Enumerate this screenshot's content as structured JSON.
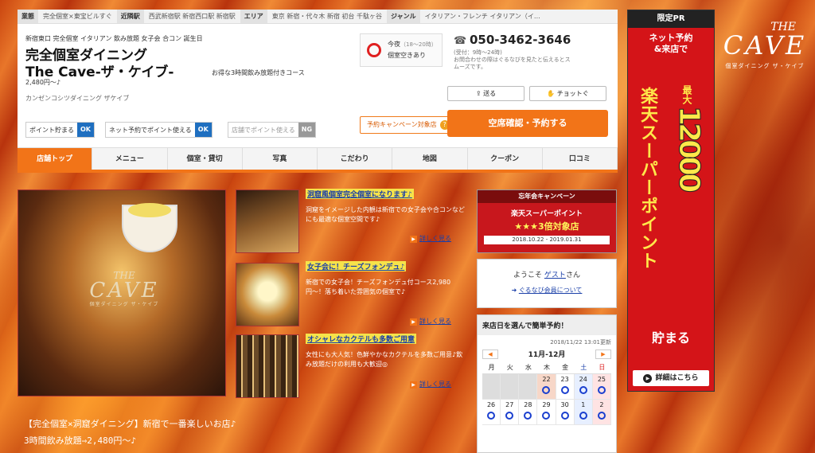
{
  "topbar": [
    {
      "key": "業態",
      "value": "完全個室×東宝ビルすぐ"
    },
    {
      "key": "近隣駅",
      "value": "西武新宿駅 新宿西口駅 新宿駅"
    },
    {
      "key": "エリア",
      "value": "東京 新宿・代々木 新宿 初台 千駄ヶ谷"
    },
    {
      "key": "ジャンル",
      "value": "イタリアン・フレンチ イタリアン（イ…"
    }
  ],
  "header": {
    "tags": "新宿東口 完全個室 イタリアン 飲み放題 女子会 合コン 誕生日",
    "title_line1": "完全個室ダイニング",
    "title_line2": "The Cave-ザ・ケイブ-",
    "subtitle": "お得な3時間飲み放題付きコース",
    "price": "2,480円〜♪",
    "kana": "カンゼンコシツダイニング ザケイブ",
    "tonight_label": "今夜",
    "tonight_hours": "（18〜20時）",
    "tonight_status": "個室空きあり",
    "phone": "050-3462-3646",
    "phone_note": "(受付：9時〜24時)\nお問合わせの際はぐるなびを見たと伝えるとスムーズです。",
    "send_label": "送る",
    "check_label": "チョットぐ",
    "points": [
      {
        "label": "ポイント貯まる",
        "badge": "OK"
      },
      {
        "label": "ネット予約でポイント使える",
        "badge": "OK"
      },
      {
        "label": "店舗でポイント使える",
        "badge": "NG"
      }
    ],
    "campaign_label": "予約キャンペーン対象店",
    "campaign_help": "?",
    "reserve_label": "空席確認・予約する"
  },
  "tabs": [
    "店舗トップ",
    "メニュー",
    "個室・貸切",
    "写真",
    "こだわり",
    "地図",
    "クーポン",
    "口コミ"
  ],
  "hero": {
    "logo_the": "THE",
    "logo_cave": "CAVE",
    "logo_kana": "個室ダイニング ザ・ケイブ"
  },
  "features": [
    {
      "title": "洞窟風個室完全個室になります♪",
      "body": "洞窟をイメージした内観は新宿での女子会や合コンなどにも最適な個室空間です♪",
      "more": "詳しく見る"
    },
    {
      "title": "女子会に！チーズフォンデュ♪",
      "body": "新宿での女子会！チーズフォンデュ付コース2,980円〜！落ち着いた雰囲気の個室で♪",
      "more": "詳しく見る"
    },
    {
      "title": "オシャレなカクテルも多数ご用意",
      "body": "女性にも大人気！色鮮やかなカクテルを多数ご用意♪飲み放題だけの利用も大歓迎◎",
      "more": "詳しく見る"
    }
  ],
  "bottom_text1": "【完全個室×洞窟ダイニング】新宿で一番楽しいお店♪",
  "bottom_text2": "3時間飲み放題⇒2,480円〜♪",
  "year_end": {
    "header": "忘年会キャンペーン",
    "line1": "楽天スーパーポイント",
    "line2": "★★★3倍対象店",
    "period": "2018.10.22 - 2019.01.31"
  },
  "welcome": {
    "greeting_prefix": "ようこそ ",
    "guest": "ゲスト",
    "greeting_suffix": "さん",
    "member_link": "ぐるなび会員について"
  },
  "calendar": {
    "header": "来店日を選んで簡単予約！",
    "updated": "2018/11/22 13:01更新",
    "month": "11月-12月",
    "prev": "◀",
    "next": "▶",
    "weekdays": [
      "月",
      "火",
      "水",
      "木",
      "金",
      "土",
      "日"
    ],
    "row1": [
      "",
      "",
      "",
      "22",
      "23",
      "24",
      "25"
    ],
    "row2": [
      "26",
      "27",
      "28",
      "29",
      "30",
      "1",
      "2"
    ]
  },
  "ad": {
    "header": "限定PR",
    "line1": "ネット予約\n&来店で",
    "vertical": "楽天スーパーポイント",
    "max": "最大",
    "big": "12000",
    "save": "貯まる",
    "detail": "詳細はこちら"
  },
  "side_logo": {
    "the": "THE",
    "cave": "CAVE",
    "kana": "個室ダイニング ザ・ケイブ"
  }
}
